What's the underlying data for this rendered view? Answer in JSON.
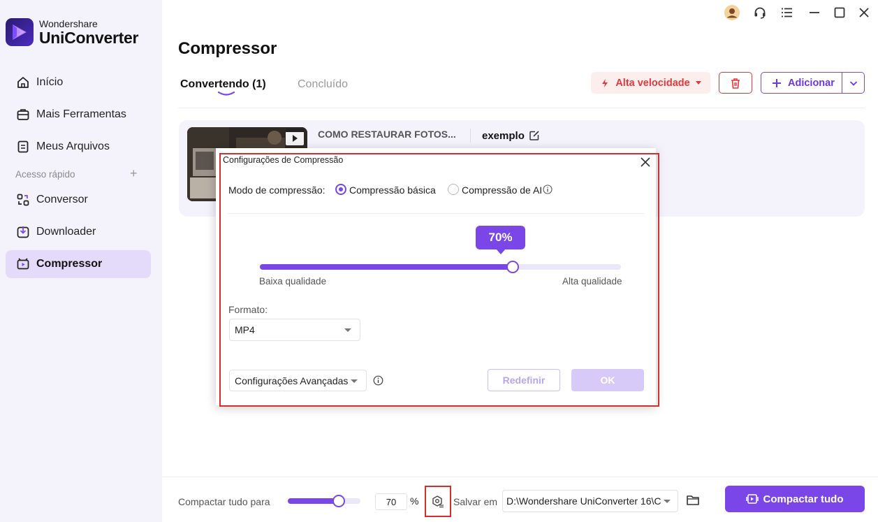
{
  "app": {
    "brand_top": "Wondershare",
    "brand_name": "UniConverter"
  },
  "sidebar": {
    "items": [
      {
        "label": "Início",
        "icon": "home-icon"
      },
      {
        "label": "Mais Ferramentas",
        "icon": "toolbox-icon"
      },
      {
        "label": "Meus Arquivos",
        "icon": "files-icon"
      },
      {
        "label": "Conversor",
        "icon": "converter-icon"
      },
      {
        "label": "Downloader",
        "icon": "downloader-icon"
      },
      {
        "label": "Compressor",
        "icon": "compressor-icon",
        "active": true
      }
    ],
    "quick_access": "Acesso rápido",
    "quick_access_add": "+"
  },
  "main": {
    "title": "Compressor",
    "tabs": [
      {
        "label": "Convertendo (1)",
        "active": true
      },
      {
        "label": "Concluído",
        "active": false
      }
    ],
    "speed_button": "Alta velocidade",
    "add_button": "Adicionar"
  },
  "file": {
    "name": "COMO RESTAURAR FOTOS...",
    "output_name": "exemplo"
  },
  "dialog": {
    "title": "Configurações de Compressão",
    "mode_label": "Modo de compressão:",
    "mode_basic": "Compressão básica",
    "mode_ai": "Compressão de AI",
    "selected_mode": "basic",
    "quality_percent": 70,
    "quality_display": "70%",
    "low_label": "Baixa qualidade",
    "high_label": "Alta qualidade",
    "format_label": "Formato:",
    "format_value": "MP4",
    "advanced_label": "Configurações Avançadas",
    "reset_button": "Redefinir",
    "ok_button": "OK"
  },
  "bottom": {
    "compress_all_label": "Compactar tudo para",
    "compress_value": 70,
    "compress_value_text": "70",
    "percent_sign": "%",
    "save_label": "Salvar em",
    "save_path": "D:\\Wondershare UniConverter 16\\C",
    "compact_all_button": "Compactar tudo"
  },
  "colors": {
    "accent": "#7a46e8",
    "danger": "#e3383c",
    "highlight": "#d32f2f",
    "sidebar_bg": "#f4f3fb"
  }
}
